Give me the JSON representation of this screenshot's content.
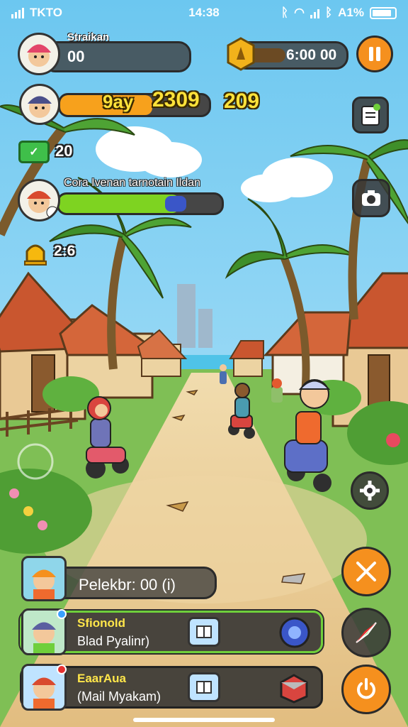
{
  "status_bar": {
    "carrier": "TKTO",
    "time": "14:38",
    "battery_text": "A1%"
  },
  "player": {
    "name": "Straikan",
    "value": "00"
  },
  "currency": {
    "value": "6:00 00"
  },
  "progress1": {
    "label": "9ay",
    "value": "2309",
    "value2": "209",
    "fill": 0.62
  },
  "reward": {
    "value": "20"
  },
  "quest": {
    "title": "Cora Ivenan tarnotain Ildan",
    "fill": 0.74
  },
  "bell": {
    "value": "2:6"
  },
  "bottom": {
    "status_text": "Pelekbr: 00 (i)",
    "cards": [
      {
        "title": "Sfionold",
        "subtitle": "Blad Pyalinr)",
        "badge_color": "#3aa0ff"
      },
      {
        "title": "EaarAua",
        "subtitle": "(Mail Myakam)",
        "badge_color": "#e53030"
      }
    ]
  },
  "icons": {
    "pause": "pause-icon",
    "notes": "clipboard-icon",
    "camera": "camera-icon",
    "settings": "gear-icon",
    "close": "crossed-tools-icon",
    "compass": "compass-arrow-icon",
    "power": "power-icon"
  },
  "colors": {
    "accent_orange": "#f5901e",
    "bar_orange": "#f7a11c",
    "bar_green": "#7ed321",
    "highlight_green": "#6fcf3b"
  }
}
